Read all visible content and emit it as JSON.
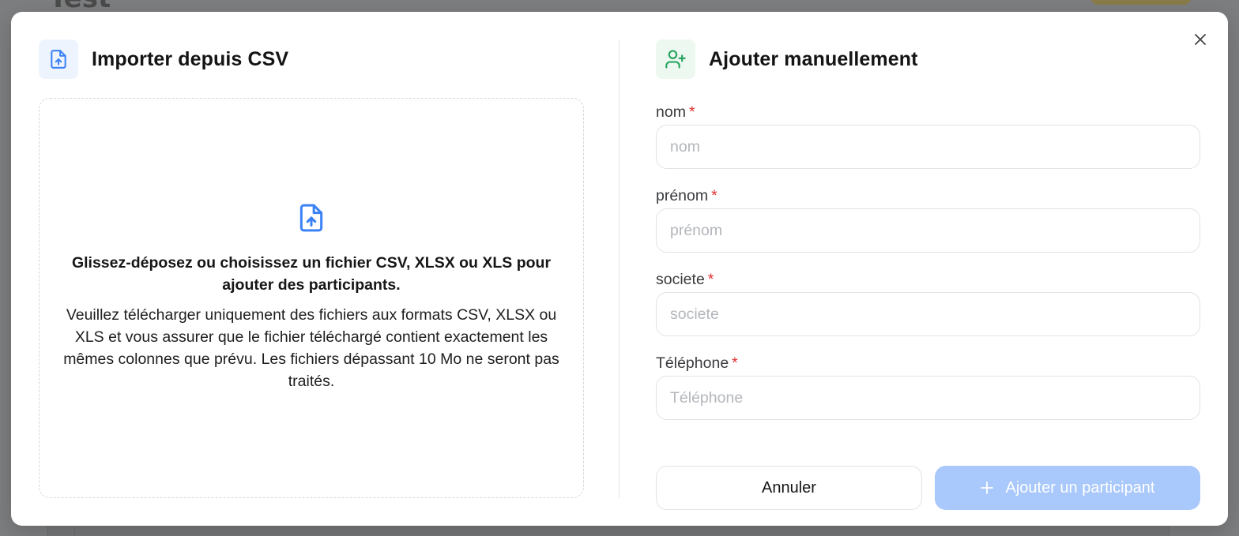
{
  "background": {
    "page_title_fragment": "Test"
  },
  "modal": {
    "close_icon": "close-icon",
    "import": {
      "title": "Importer depuis CSV",
      "icon": "file-upload-icon",
      "dropzone": {
        "icon": "file-upload-icon",
        "title": "Glissez-déposez ou choisissez un fichier CSV, XLSX ou XLS pour ajouter des participants.",
        "description": "Veuillez télécharger uniquement des fichiers aux formats CSV, XLSX ou XLS et vous assurer que le fichier téléchargé contient exactement les mêmes colonnes que prévu. Les fichiers dépassant 10 Mo ne seront pas traités."
      }
    },
    "manual": {
      "title": "Ajouter manuellement",
      "icon": "user-plus-icon",
      "fields": [
        {
          "label": "nom",
          "placeholder": "nom",
          "required": "*",
          "value": ""
        },
        {
          "label": "prénom",
          "placeholder": "prénom",
          "required": "*",
          "value": ""
        },
        {
          "label": "societe",
          "placeholder": "societe",
          "required": "*",
          "value": ""
        },
        {
          "label": "Téléphone",
          "placeholder": "Téléphone",
          "required": "*",
          "value": ""
        }
      ],
      "cancel_label": "Annuler",
      "submit_label": "Ajouter un participant",
      "submit_icon": "plus-icon"
    }
  },
  "colors": {
    "accent_blue": "#3b82f6",
    "accent_green": "#22a35a",
    "required_red": "#e03131",
    "submit_disabled": "#a9c8fb"
  }
}
